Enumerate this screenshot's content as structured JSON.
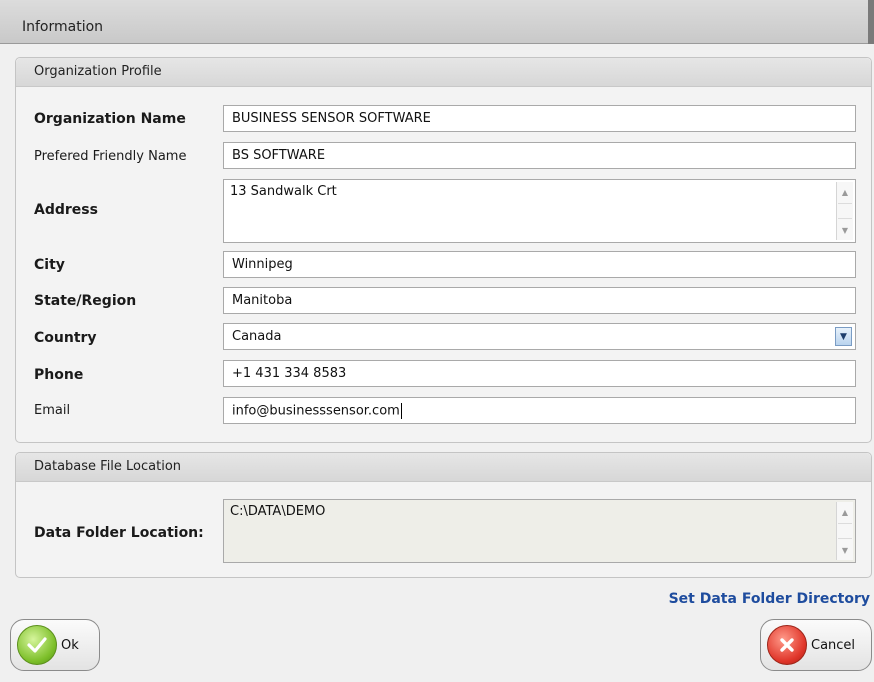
{
  "window": {
    "title": "Information"
  },
  "profile": {
    "header": "Organization Profile",
    "fields": {
      "org_name": {
        "label": "Organization Name",
        "value": "BUSINESS SENSOR SOFTWARE"
      },
      "friendly": {
        "label": "Prefered Friendly Name",
        "value": "BS SOFTWARE"
      },
      "address": {
        "label": "Address",
        "value": "13 Sandwalk Crt"
      },
      "city": {
        "label": "City",
        "value": "Winnipeg"
      },
      "state": {
        "label": "State/Region",
        "value": "Manitoba"
      },
      "country": {
        "label": "Country",
        "value": "Canada"
      },
      "phone": {
        "label": "Phone",
        "value": "+1 431 334 8583"
      },
      "email": {
        "label": "Email",
        "value": "info@businesssensor.com"
      }
    }
  },
  "database": {
    "header": "Database File Location",
    "folder_label": "Data Folder Location:",
    "folder_value": "C:\\DATA\\DEMO"
  },
  "actions": {
    "set_folder_link": "Set Data Folder Directory",
    "ok_label": "Ok",
    "cancel_label": "Cancel"
  },
  "icons": {
    "ok": "checkmark-icon",
    "cancel": "close-x-icon",
    "dropdown": "chevron-down-icon",
    "scroll_up": "arrow-up-icon",
    "scroll_down": "arrow-down-icon"
  },
  "colors": {
    "link": "#1e4c9e",
    "ok_green": "#7dbf2a",
    "cancel_red": "#e0362a"
  }
}
